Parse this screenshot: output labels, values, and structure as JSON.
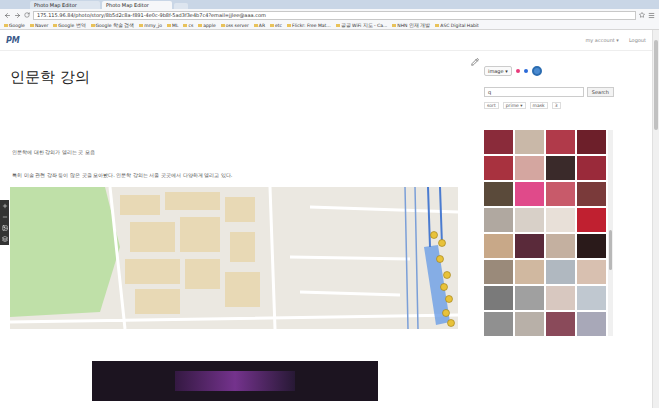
{
  "browser": {
    "tabs": [
      {
        "label": "Photo Map Editor",
        "selected": false
      },
      {
        "label": "Photo Map Editor",
        "selected": true
      }
    ],
    "url": "175.115.96.84/photo/story/8b5d2c8a-f891-4e0c-9b8f-5ad3f3e4b7c4?email=jjlee@aaa.com",
    "bookmarks": [
      "Google",
      "Naver",
      "Google 번역",
      "Google 학술 검색",
      "mmy_jo",
      "ML",
      "cs",
      "apple",
      "oss server",
      "AR",
      "etc",
      "Flickr: Free Mat...",
      "공공 WiFi 지도 - Ca...",
      "NHN 인재 개발",
      "ASC Digital Habit"
    ]
  },
  "header": {
    "logo": "PM",
    "links": [
      "my account ▾",
      "Logout"
    ]
  },
  "main": {
    "title": "인문학 강의",
    "paragraphs": [
      "인문학에 대한 강의가 열리는 곳 모음",
      "특히 미술 관련 강좌 등이 많은 곳을 모아봤다. 인문학 강의는 서울 곳곳에서 다양하게 열리고 있다."
    ]
  },
  "sidebar": {
    "source": "image ▾",
    "search": {
      "value": "q",
      "button": "Search"
    },
    "filters": [
      "sort",
      "prime ▾",
      "mask",
      "3"
    ],
    "photos": [
      {
        "color": "#8a2b3a"
      },
      {
        "color": "#c9b8a8"
      },
      {
        "color": "#b03a4a"
      },
      {
        "color": "#6d1f2a"
      },
      {
        "color": "#a8323f"
      },
      {
        "color": "#d4a6a0"
      },
      {
        "color": "#3a2a2a"
      },
      {
        "color": "#9a2a3a"
      },
      {
        "color": "#5a4a3a"
      },
      {
        "color": "#e04a8a"
      },
      {
        "color": "#c85a6a"
      },
      {
        "color": "#7a3a3a"
      },
      {
        "color": "#b0a8a0"
      },
      {
        "color": "#d8d0c8"
      },
      {
        "color": "#e8e0d8"
      },
      {
        "color": "#c02030"
      },
      {
        "color": "#c8a888"
      },
      {
        "color": "#5a2a3a"
      },
      {
        "color": "#c4b0a0"
      },
      {
        "color": "#2a1a1a"
      },
      {
        "color": "#9a8a7a"
      },
      {
        "color": "#d0b8a0"
      },
      {
        "color": "#b0b8c0"
      },
      {
        "color": "#d8c0b0"
      },
      {
        "color": "#7a7a7a"
      },
      {
        "color": "#a0a0a0"
      },
      {
        "color": "#d8c8c0"
      },
      {
        "color": "#c0c8d0"
      },
      {
        "color": "#909090"
      },
      {
        "color": "#b8b0a8"
      },
      {
        "color": "#8a4a5a"
      },
      {
        "color": "#a8a8b8"
      }
    ]
  }
}
